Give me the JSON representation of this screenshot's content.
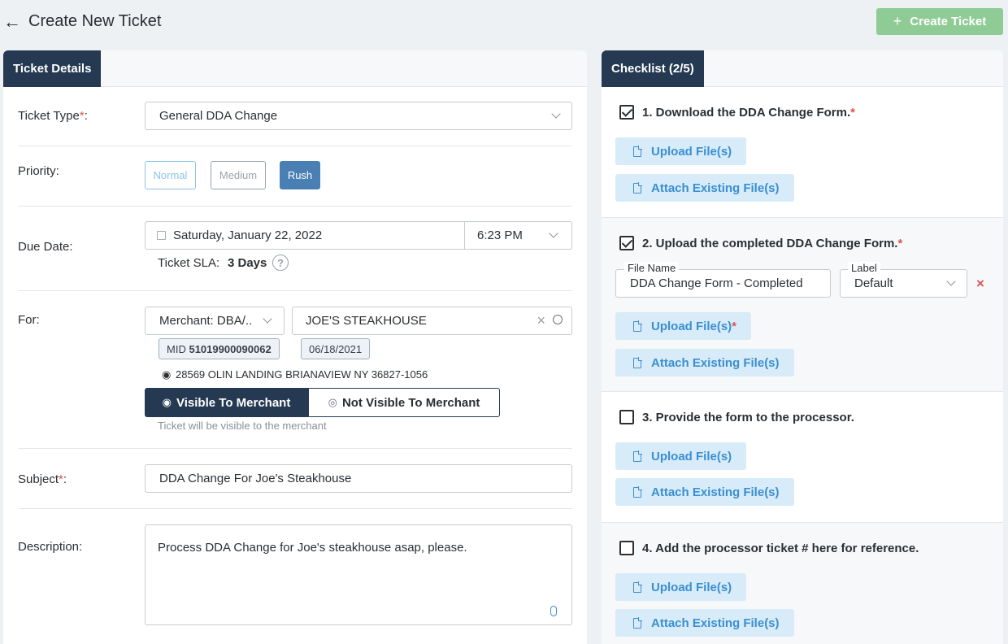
{
  "header": {
    "title": "Create New Ticket",
    "create_label": "Create Ticket"
  },
  "tabs": {
    "details": "Ticket Details",
    "checklist": "Checklist (2/5)"
  },
  "form": {
    "ticket_type_label": "Ticket Type",
    "ticket_type_value": "General DDA Change",
    "priority_label": "Priority:",
    "priorities": [
      "Normal",
      "Medium",
      "Rush"
    ],
    "priority_selected": "Rush",
    "due_date_label": "Due Date:",
    "due_date_value": "Saturday, January 22, 2022",
    "due_time_value": "6:23 PM",
    "sla_label": "Ticket SLA:",
    "sla_value": "3 Days",
    "for_label": "For:",
    "for_type": "Merchant: DBA/..",
    "for_value": "JOE'S STEAKHOUSE",
    "mid_label": "MID",
    "mid_value": "51019900090062",
    "merchant_date": "06/18/2021",
    "address": "28569 OLIN LANDING BRIANAVIEW NY 36827-1056",
    "visible_label": "Visible To Merchant",
    "not_visible_label": "Not Visible To Merchant",
    "visibility_note": "Ticket will be visible to the merchant",
    "subject_label": "Subject",
    "subject_value": "DDA Change For Joe's Steakhouse",
    "description_label": "Description:",
    "description_value": "Process DDA Change for Joe's steakhouse asap, please."
  },
  "checklist": {
    "items": [
      {
        "title": "1. Download the DDA Change Form.",
        "required": true,
        "checked": true
      },
      {
        "title": "2. Upload the completed DDA Change Form.",
        "required": true,
        "checked": true
      },
      {
        "title": "3. Provide the form to the processor.",
        "required": false,
        "checked": false
      },
      {
        "title": "4. Add the processor ticket # here for reference.",
        "required": false,
        "checked": false
      }
    ],
    "upload_label": "Upload File(s)",
    "attach_label": "Attach Existing File(s)",
    "file_name_legend": "File Name",
    "file_name_value": "DDA Change Form - Completed",
    "label_legend": "Label",
    "label_value": "Default"
  },
  "colors": {
    "navy": "#253a52",
    "green": "#8fcc95",
    "blue": "#3b8fd1",
    "required": "#d9534f"
  }
}
